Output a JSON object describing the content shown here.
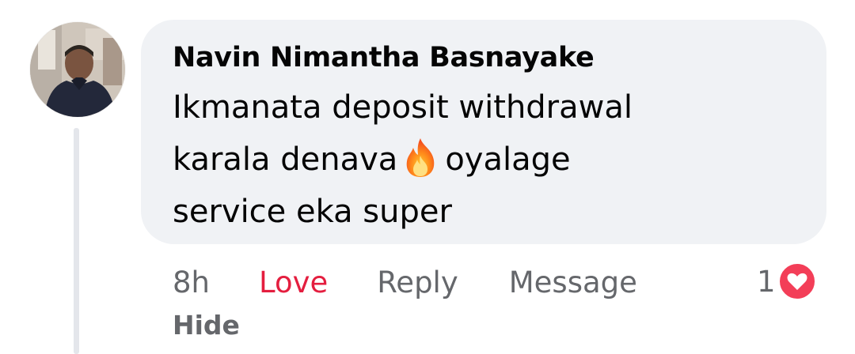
{
  "comment": {
    "author": "Navin Nimantha Basnayake",
    "text_lines": [
      "Ikmanata deposit withdrawal",
      "karala denava",
      "oyalage",
      "service eka super"
    ],
    "emoji": "fire-icon"
  },
  "actions": {
    "time": "8h",
    "love": "Love",
    "reply": "Reply",
    "message": "Message",
    "hide": "Hide"
  },
  "reactions": {
    "count": "1",
    "icon": "love-reaction-icon"
  },
  "colors": {
    "bubble_bg": "#f0f2f5",
    "love_active": "#e41e3f",
    "secondary_text": "#65676b",
    "primary_text": "#050505"
  }
}
